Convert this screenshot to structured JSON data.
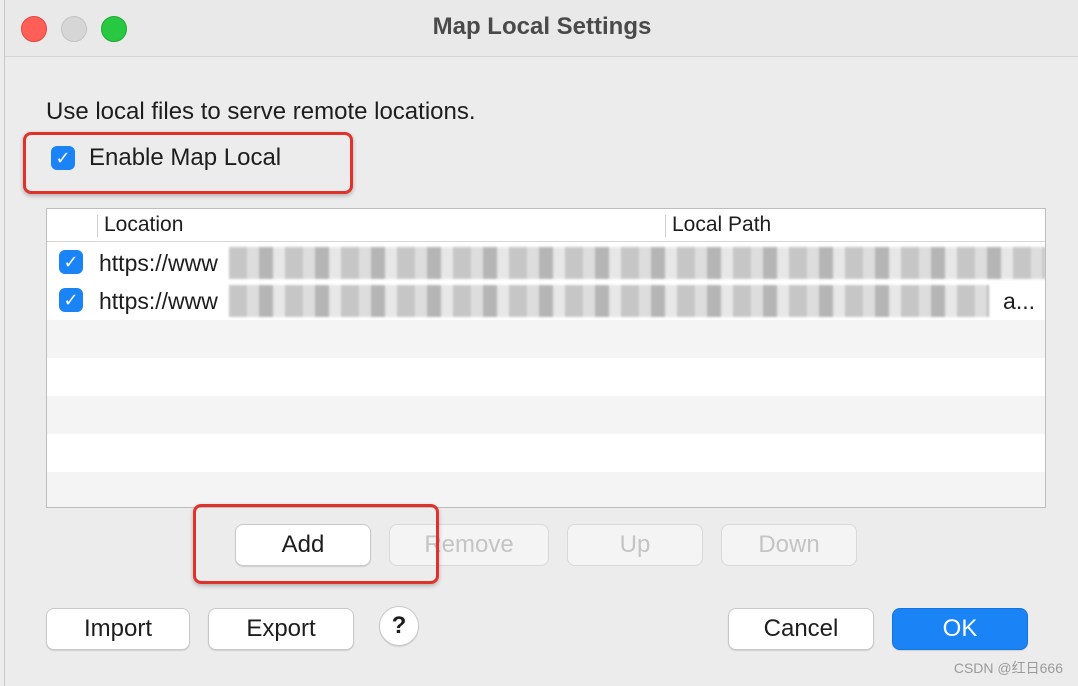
{
  "window": {
    "title": "Map Local Settings"
  },
  "description": "Use local files to serve remote locations.",
  "enable": {
    "label": "Enable Map Local",
    "checked": true
  },
  "table": {
    "columns": [
      "Location",
      "Local Path"
    ],
    "rows": [
      {
        "checked": true,
        "location": "https://www",
        "local_path_suffix": ""
      },
      {
        "checked": true,
        "location": "https://www",
        "local_path_suffix": "a..."
      }
    ]
  },
  "row_buttons": {
    "add": "Add",
    "remove": "Remove",
    "up": "Up",
    "down": "Down"
  },
  "footer": {
    "import": "Import",
    "export": "Export",
    "help": "?",
    "cancel": "Cancel",
    "ok": "OK"
  },
  "watermark": "CSDN @红日666",
  "colors": {
    "accent": "#1a84f6",
    "highlight": "#e0312b"
  }
}
